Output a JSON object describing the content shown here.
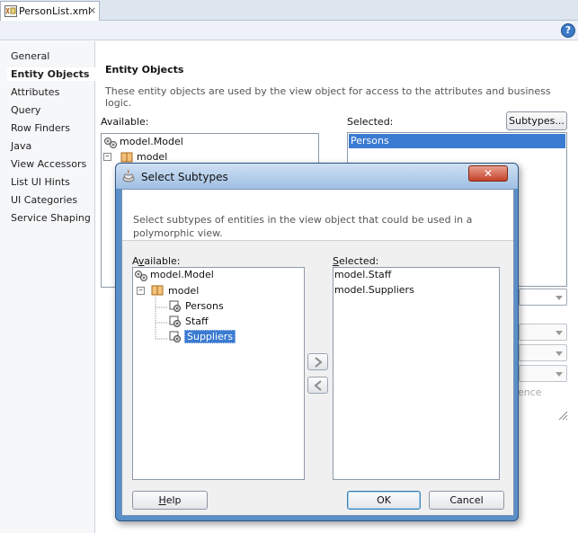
{
  "file_tab": {
    "label": "PersonList.xml",
    "close": "×",
    "icon": "xml-file-icon"
  },
  "toolbar": {
    "help": "?"
  },
  "nav": {
    "items": [
      {
        "label": "General",
        "active": false
      },
      {
        "label": "Entity Objects",
        "active": true
      },
      {
        "label": "Attributes",
        "active": false
      },
      {
        "label": "Query",
        "active": false
      },
      {
        "label": "Row Finders",
        "active": false
      },
      {
        "label": "Java",
        "active": false
      },
      {
        "label": "View Accessors",
        "active": false
      },
      {
        "label": "List UI Hints",
        "active": false
      },
      {
        "label": "UI Categories",
        "active": false
      },
      {
        "label": "Service Shaping",
        "active": false
      }
    ]
  },
  "main": {
    "title": "Entity Objects",
    "description": "These entity objects are used by the view object for access to the attributes and business logic.",
    "available_label": "Available:",
    "available_tree": [
      {
        "label": "model.Model",
        "icon": "model-project-icon"
      },
      {
        "label": "model",
        "icon": "package-icon"
      }
    ],
    "selected_label": "Selected:",
    "subtypes_button": "Subtypes...",
    "selected_items": [
      "Persons"
    ],
    "hidden_partial_text": "ence"
  },
  "dialog": {
    "title": "Select Subtypes",
    "close": "✕",
    "description": "Select subtypes of entities in the view object that could be used in a polymorphic view.",
    "available_label_pre": "A",
    "available_label_ul": "v",
    "available_label_post": "ailable:",
    "selected_label_pre": "",
    "selected_label_ul": "S",
    "selected_label_post": "elected:",
    "available_tree": [
      {
        "label": "model.Model",
        "icon": "model-project-icon"
      },
      {
        "label": "model",
        "icon": "package-icon"
      },
      {
        "label": "Persons",
        "icon": "entity-object-icon"
      },
      {
        "label": "Staff",
        "icon": "entity-object-icon"
      },
      {
        "label": "Suppliers",
        "icon": "entity-object-icon",
        "selected": true
      }
    ],
    "selected_items": [
      "model.Staff",
      "model.Suppliers"
    ],
    "help_button_pre": "",
    "help_button_ul": "H",
    "help_button_post": "elp",
    "ok_button": "OK",
    "cancel_button": "Cancel",
    "add_arrow": "move-right-icon",
    "remove_arrow": "move-left-icon"
  }
}
